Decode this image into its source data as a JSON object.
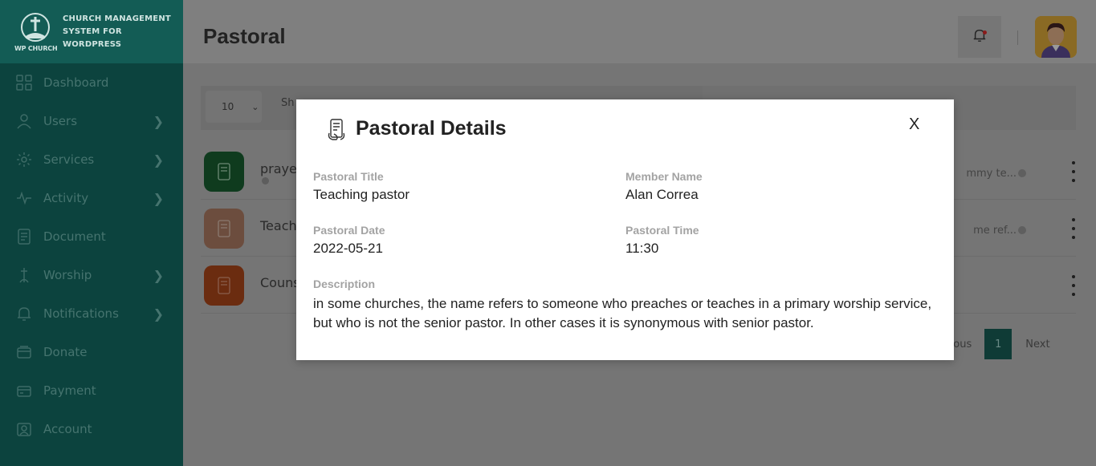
{
  "brand": {
    "logo_text": "WP CHURCH",
    "name": "CHURCH MANAGEMENT SYSTEM FOR WORDPRESS"
  },
  "sidebar": {
    "items": [
      {
        "label": "Dashboard",
        "icon": "dashboard-icon",
        "has_submenu": false
      },
      {
        "label": "Users",
        "icon": "user-icon",
        "has_submenu": true
      },
      {
        "label": "Services",
        "icon": "services-icon",
        "has_submenu": true
      },
      {
        "label": "Activity",
        "icon": "activity-icon",
        "has_submenu": true
      },
      {
        "label": "Document",
        "icon": "document-icon",
        "has_submenu": false
      },
      {
        "label": "Worship",
        "icon": "worship-icon",
        "has_submenu": true
      },
      {
        "label": "Notifications",
        "icon": "bell-icon",
        "has_submenu": true
      },
      {
        "label": "Donate",
        "icon": "donate-icon",
        "has_submenu": false
      },
      {
        "label": "Payment",
        "icon": "payment-icon",
        "has_submenu": false
      },
      {
        "label": "Account",
        "icon": "account-icon",
        "has_submenu": false
      }
    ]
  },
  "header": {
    "title": "Pastoral"
  },
  "table": {
    "page_size": "10",
    "search_label": "Sh",
    "rows": [
      {
        "title": "praye",
        "icon_color": "#0f3b1e",
        "desc": "mmy te..."
      },
      {
        "title": "Teach",
        "icon_color": "#6c4d3e",
        "desc": "me ref..."
      },
      {
        "title": "Couns",
        "icon_color": "#6b2c10",
        "desc": ""
      }
    ],
    "pager": {
      "prev": "evious",
      "current": "1",
      "next": "Next"
    }
  },
  "modal": {
    "title": "Pastoral Details",
    "close_label": "X",
    "fields": {
      "pastoral_title_label": "Pastoral Title",
      "pastoral_title_value": "Teaching pastor",
      "member_name_label": "Member Name",
      "member_name_value": "Alan Correa",
      "pastoral_date_label": "Pastoral Date",
      "pastoral_date_value": "2022-05-21",
      "pastoral_time_label": "Pastoral Time",
      "pastoral_time_value": "11:30",
      "description_label": "Description",
      "description_value": "in some churches, the name refers to someone who preaches or teaches in a primary worship service, but who is not the senior pastor. In other cases it is synonymous with senior pastor."
    }
  },
  "colors": {
    "sidebar_bg": "#0c433e",
    "brand_bg": "#135c55",
    "accent": "#0f3b36"
  }
}
